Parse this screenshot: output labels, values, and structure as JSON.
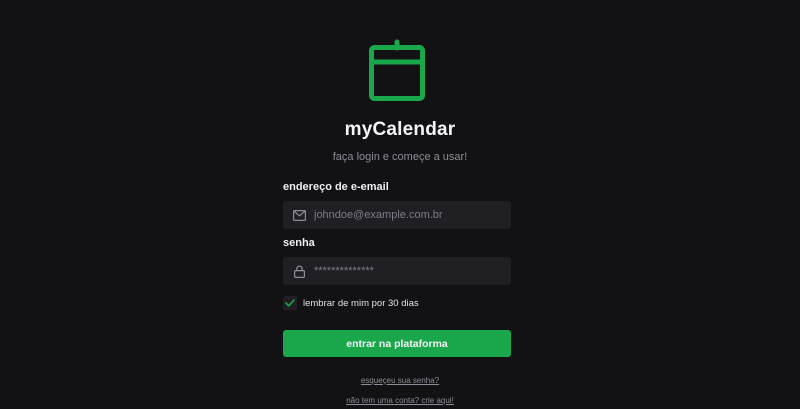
{
  "app": {
    "title": "myCalendar",
    "subtitle": "faça login e começe a usar!",
    "logo_icon": "calendar-icon",
    "accent_color": "#1aa64b"
  },
  "form": {
    "email": {
      "label": "endereço de e-email",
      "placeholder": "johndoe@example.com.br",
      "icon": "envelope-icon"
    },
    "password": {
      "label": "senha",
      "value": "**************",
      "icon": "lock-icon"
    },
    "remember": {
      "label": "lembrar de mim por 30 dias",
      "checked": true
    },
    "submit_label": "entrar na plataforma"
  },
  "links": {
    "forgot_password": "esqueçeu sua senha?",
    "sign_up": "não tem uma conta? crie aqui!"
  }
}
